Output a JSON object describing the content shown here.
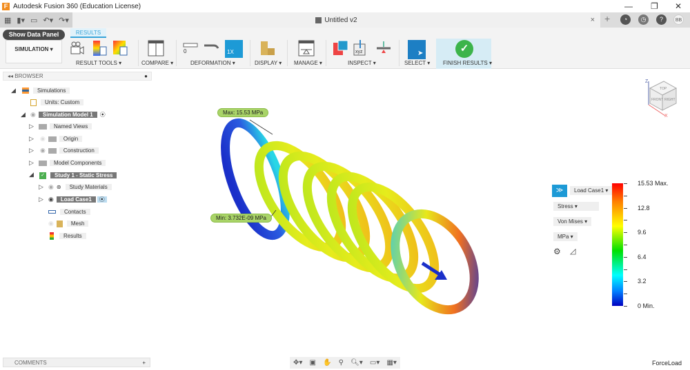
{
  "app": {
    "title": "Autodesk Fusion 360 (Education License)",
    "logo": "F",
    "window_controls": [
      "—",
      "❐",
      "✕"
    ]
  },
  "document": {
    "tab_title": "Untitled v2",
    "close": "×"
  },
  "top_right": {
    "add": "+",
    "avatar": "BB",
    "icons": [
      "job-status-icon",
      "notifications-icon",
      "help-icon"
    ]
  },
  "toolbar": {
    "show_data_panel": "Show Data Panel",
    "results_tab": "RESULTS",
    "workspace": "SIMULATION ▾",
    "groups": [
      "RESULT TOOLS ▾",
      "COMPARE ▾",
      "DEFORMATION ▾",
      "DISPLAY ▾",
      "MANAGE ▾",
      "INSPECT ▾",
      "SELECT ▾",
      "FINISH RESULTS ▾"
    ],
    "deformation_zero": "0",
    "deformation_scale": "1X",
    "inspect_xyz": "xyz"
  },
  "browser": {
    "title": "BROWSER",
    "nodes": [
      {
        "label": "Simulations"
      },
      {
        "label": "Units: Custom"
      },
      {
        "label": "Simulation Model 1"
      },
      {
        "label": "Named Views"
      },
      {
        "label": "Origin"
      },
      {
        "label": "Construction"
      },
      {
        "label": "Model Components"
      },
      {
        "label": "Study 1 - Static Stress"
      },
      {
        "label": "Study Materials"
      },
      {
        "label": "Load Case1"
      },
      {
        "label": "Contacts"
      },
      {
        "label": "Mesh"
      },
      {
        "label": "Results"
      }
    ]
  },
  "viewport": {
    "max_label": "Max: 15.53 MPa",
    "min_label": "Min: 3.732E-09 MPa",
    "viewcube": {
      "top": "TOP",
      "front": "FRONT",
      "right": "RIGHT",
      "z": "Z",
      "x": "X"
    },
    "result_controls": {
      "load_case": "Load Case1 ▾",
      "result_type": "Stress ▾",
      "component": "Von Mises ▾",
      "units": "MPa ▾"
    },
    "legend": {
      "labels": [
        "15.53 Max.",
        "12.8",
        "9.6",
        "6.4",
        "3.2",
        "0 Min."
      ],
      "range": [
        0,
        15.53
      ],
      "units": "MPa"
    },
    "status": "ForceLoad"
  },
  "comments": {
    "title": "COMMENTS",
    "count_icon": "+"
  }
}
